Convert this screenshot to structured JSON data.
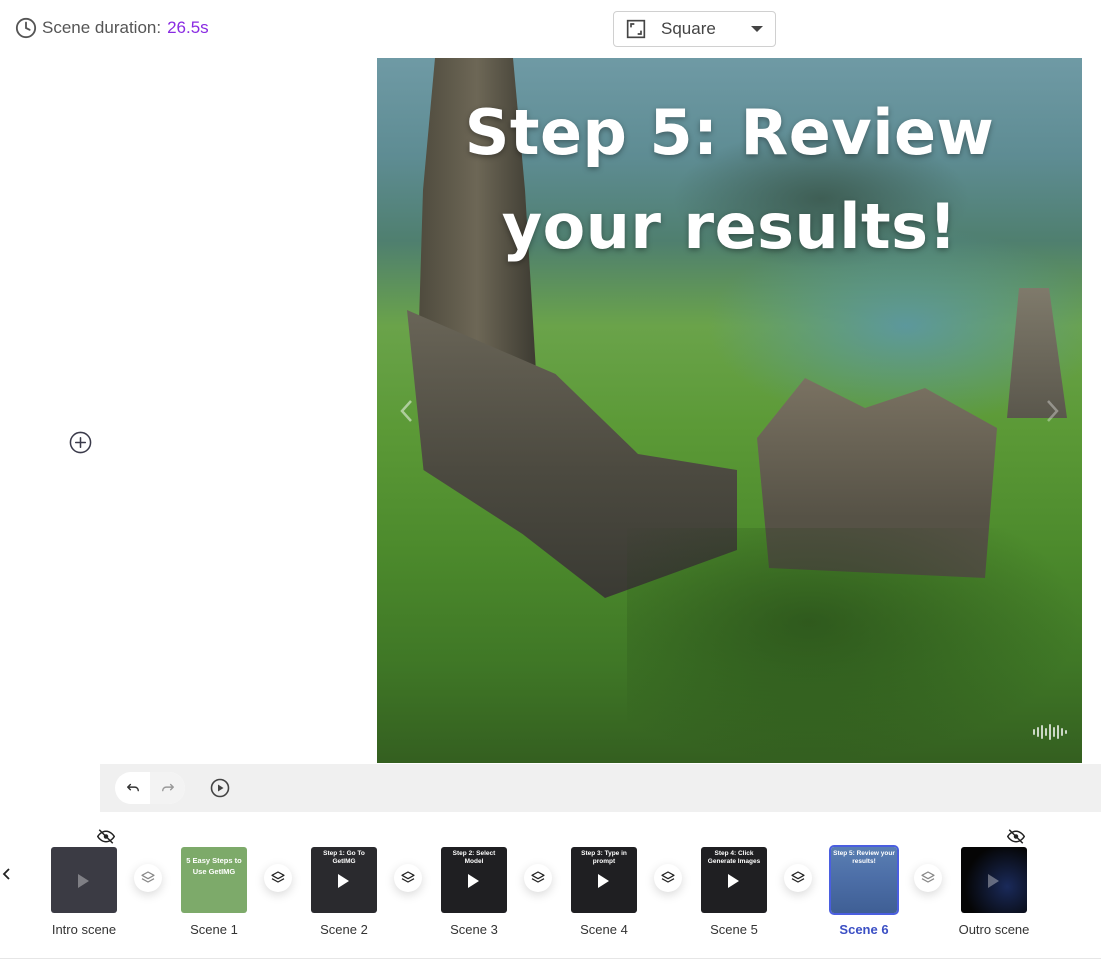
{
  "header": {
    "duration_label": "Scene duration:",
    "duration_value": "26.5s",
    "ratio": {
      "selected": "Square"
    }
  },
  "canvas": {
    "title_line1": "Step 5: Review",
    "title_line2": "your results!"
  },
  "timeline": {
    "scenes": [
      {
        "label": "Intro scene",
        "thumb_text": "",
        "hidden": true,
        "active": false
      },
      {
        "label": "Scene 1",
        "thumb_text": "5 Easy Steps to Use GetIMG",
        "hidden": false,
        "active": false
      },
      {
        "label": "Scene 2",
        "thumb_text": "Step 1: Go To GetIMG",
        "hidden": false,
        "active": false
      },
      {
        "label": "Scene 3",
        "thumb_text": "Step 2: Select Model",
        "hidden": false,
        "active": false
      },
      {
        "label": "Scene 4",
        "thumb_text": "Step 3: Type in prompt",
        "hidden": false,
        "active": false
      },
      {
        "label": "Scene 5",
        "thumb_text": "Step 4: Click Generate Images",
        "hidden": false,
        "active": false
      },
      {
        "label": "Scene 6",
        "thumb_text": "Step 5: Review your results!",
        "hidden": false,
        "active": true
      },
      {
        "label": "Outro scene",
        "thumb_text": "",
        "hidden": true,
        "active": false
      }
    ]
  },
  "colors": {
    "accent": "#8a2be2",
    "active_scene": "#3b4fc4",
    "scene1_bg": "#7daa6a",
    "dark_scene_bg": "#1f1f22"
  }
}
